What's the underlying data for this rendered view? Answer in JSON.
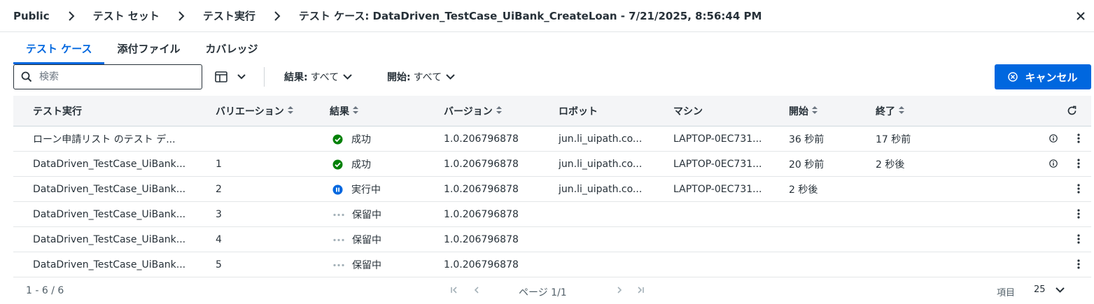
{
  "breadcrumb": {
    "items": [
      "Public",
      "テスト セット",
      "テスト実行"
    ],
    "current": "テスト ケース: DataDriven_TestCase_UiBank_CreateLoan - 7/21/2025, 8:56:44 PM"
  },
  "tabs": [
    "テスト ケース",
    "添付ファイル",
    "カバレッジ"
  ],
  "active_tab": 0,
  "toolbar": {
    "search_placeholder": "検索",
    "filter_result_label": "結果:",
    "filter_result_value": "すべて",
    "filter_start_label": "開始:",
    "filter_start_value": "すべて",
    "cancel_label": "キャンセル"
  },
  "table": {
    "columns": [
      "テスト実行",
      "バリエーション",
      "結果",
      "バージョン",
      "ロボット",
      "マシン",
      "開始",
      "終了"
    ],
    "rows": [
      {
        "name": "ローン申請リスト のテスト デ...",
        "variation": "",
        "status": "success",
        "result": "成功",
        "version": "1.0.206796878",
        "robot": "jun.li_uipath.co...",
        "machine": "LAPTOP-0EC731...",
        "start": "36 秒前",
        "end": "17 秒前",
        "info": true
      },
      {
        "name": "DataDriven_TestCase_UiBank...",
        "variation": "1",
        "status": "success",
        "result": "成功",
        "version": "1.0.206796878",
        "robot": "jun.li_uipath.co...",
        "machine": "LAPTOP-0EC731...",
        "start": "20 秒前",
        "end": "2 秒後",
        "info": true
      },
      {
        "name": "DataDriven_TestCase_UiBank...",
        "variation": "2",
        "status": "running",
        "result": "実行中",
        "version": "1.0.206796878",
        "robot": "jun.li_uipath.co...",
        "machine": "LAPTOP-0EC731...",
        "start": "2 秒後",
        "end": "",
        "info": false
      },
      {
        "name": "DataDriven_TestCase_UiBank...",
        "variation": "3",
        "status": "pending",
        "result": "保留中",
        "version": "1.0.206796878",
        "robot": "",
        "machine": "",
        "start": "",
        "end": "",
        "info": false
      },
      {
        "name": "DataDriven_TestCase_UiBank...",
        "variation": "4",
        "status": "pending",
        "result": "保留中",
        "version": "1.0.206796878",
        "robot": "",
        "machine": "",
        "start": "",
        "end": "",
        "info": false
      },
      {
        "name": "DataDriven_TestCase_UiBank...",
        "variation": "5",
        "status": "pending",
        "result": "保留中",
        "version": "1.0.206796878",
        "robot": "",
        "machine": "",
        "start": "",
        "end": "",
        "info": false
      }
    ]
  },
  "footer": {
    "range": "1 - 6 / 6",
    "page": "ページ 1/1",
    "items_label": "項目",
    "page_size": "25"
  },
  "colors": {
    "accent": "#0067df",
    "success": "#038108",
    "running": "#0067df",
    "pending": "#a4b1b8"
  }
}
